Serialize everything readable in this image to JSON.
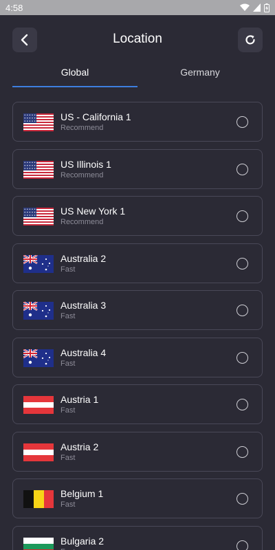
{
  "status_bar": {
    "time": "4:58",
    "icons": [
      "wifi-icon",
      "signal-icon",
      "battery-icon"
    ]
  },
  "header": {
    "title": "Location",
    "back_icon": "chevron-left-icon",
    "refresh_icon": "refresh-icon"
  },
  "tabs": [
    {
      "label": "Global",
      "selected": true
    },
    {
      "label": "Germany",
      "selected": false
    }
  ],
  "colors": {
    "background": "#2b2a35",
    "accent": "#3d7fe0",
    "row_border": "#4a4958",
    "subtext": "#8d8c98"
  },
  "locations": [
    {
      "name": "US - California 1",
      "sub": "Recommend",
      "flag": "us"
    },
    {
      "name": "US Illinois 1",
      "sub": "Recommend",
      "flag": "us"
    },
    {
      "name": "US New York 1",
      "sub": "Recommend",
      "flag": "us"
    },
    {
      "name": "Australia 2",
      "sub": "Fast",
      "flag": "au"
    },
    {
      "name": "Australia 3",
      "sub": "Fast",
      "flag": "au"
    },
    {
      "name": "Australia 4",
      "sub": "Fast",
      "flag": "au"
    },
    {
      "name": "Austria 1",
      "sub": "Fast",
      "flag": "at"
    },
    {
      "name": "Austria 2",
      "sub": "Fast",
      "flag": "at"
    },
    {
      "name": "Belgium 1",
      "sub": "Fast",
      "flag": "be"
    },
    {
      "name": "Bulgaria 2",
      "sub": "Fast",
      "flag": "bg"
    }
  ]
}
